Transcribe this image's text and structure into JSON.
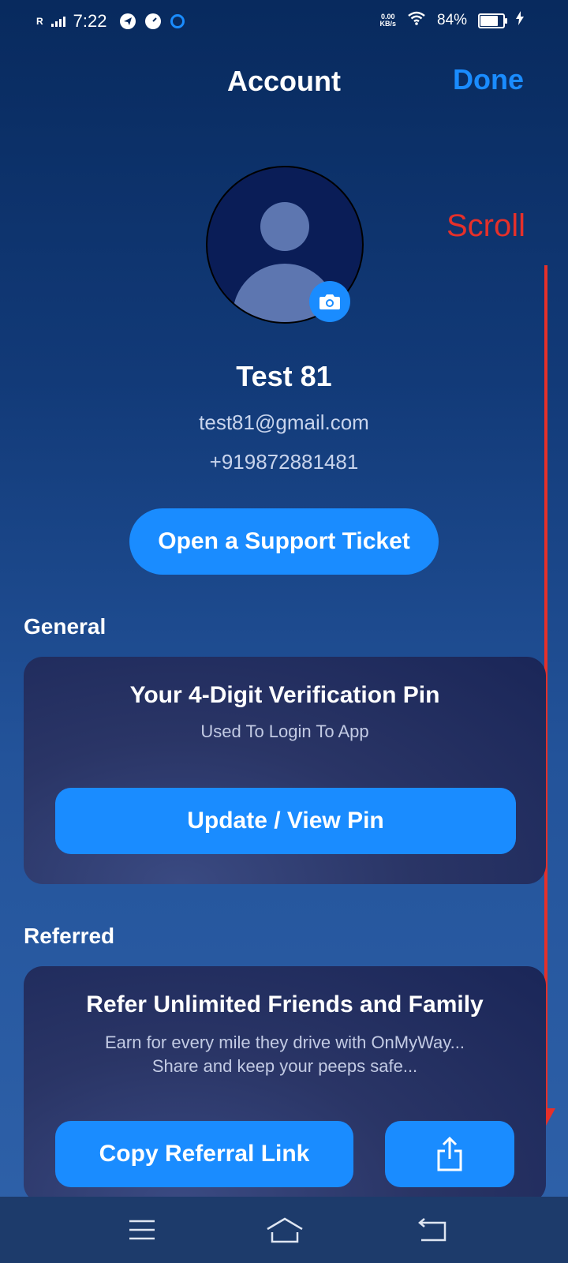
{
  "status_bar": {
    "carrier_marker": "R",
    "time": "7:22",
    "net_speed_value": "0.00",
    "net_speed_unit": "KB/s",
    "battery_percent": "84%",
    "battery_level": 0.84,
    "icons": [
      "telegram-icon",
      "speedometer-icon",
      "sync-app-icon",
      "wifi-icon",
      "battery-icon",
      "charging-bolt-icon"
    ]
  },
  "header": {
    "title": "Account",
    "done_label": "Done"
  },
  "annotation": {
    "scroll_label": "Scroll",
    "color": "#e5302a"
  },
  "profile": {
    "name": "Test 81",
    "email": "test81@gmail.com",
    "phone": "+919872881481",
    "avatar_icon": "person-placeholder-icon",
    "camera_icon": "camera-icon"
  },
  "support": {
    "button_label": "Open a Support Ticket"
  },
  "general": {
    "section_title": "General",
    "card_title": "Your 4-Digit Verification Pin",
    "card_subtitle": "Used To Login To App",
    "button_label": "Update / View Pin"
  },
  "referred": {
    "section_title": "Referred",
    "card_title": "Refer Unlimited Friends and Family",
    "card_line1": "Earn for every mile they drive with OnMyWay...",
    "card_line2": "Share and keep your peeps safe...",
    "copy_button_label": "Copy Referral Link",
    "share_icon": "share-icon"
  },
  "nav_bar": {
    "items": [
      "menu-icon",
      "home-icon",
      "back-icon"
    ]
  },
  "colors": {
    "accent": "#1a8cff",
    "background_top": "#082a5e",
    "background_bottom": "#2f62aa",
    "card": "#2a3566",
    "nav_bar": "#1d3b6b"
  }
}
